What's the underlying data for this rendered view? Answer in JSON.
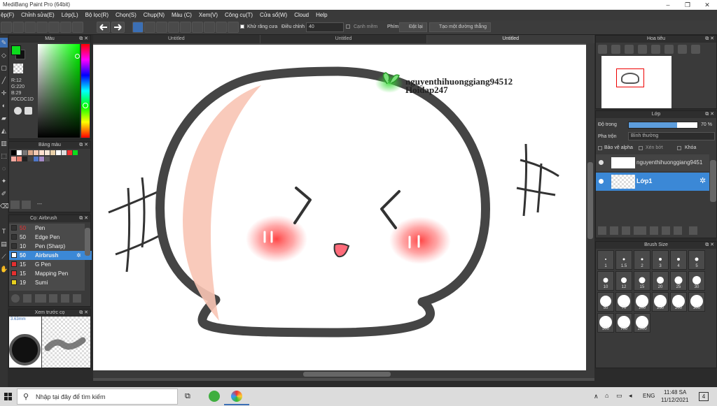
{
  "window": {
    "title": "MediBang Paint Pro (64bit)"
  },
  "menu": [
    "ệp(F)",
    "Chỉnh sửa(E)",
    "Lớp(L)",
    "Bộ lọc(R)",
    "Chọn(S)",
    "Chụp(N)",
    "Màu (C)",
    "Xem(V)",
    "Công cụ(T)",
    "Cửa sổ(W)",
    "Cloud",
    "Help"
  ],
  "toolbar": {
    "antialias_label": "Khử răng cưa",
    "correction_label": "Điều chỉnh",
    "correction_value": "40",
    "edge_label": "Cạnh mềm",
    "key_label": "Phím",
    "reset_label": "Đặt lại",
    "line_label": "Tạo một đường thẳng"
  },
  "tabs": [
    "Untitled",
    "Untitled",
    "Untitled"
  ],
  "color_panel": {
    "title": "Màu",
    "r": "R:12",
    "g": "G:220",
    "b": "B:29",
    "hex": "#0CDC1D",
    "current_color": "#0cdc1d"
  },
  "palette_panel": {
    "title": "Bảng màu",
    "footer": "---"
  },
  "brush_panel": {
    "title": "Cọ: Airbrush",
    "items": [
      {
        "size": "50",
        "name": "Pen",
        "color": "#333333"
      },
      {
        "size": "50",
        "name": "Edge Pen",
        "color": "#333333"
      },
      {
        "size": "10",
        "name": "Pen (Sharp)",
        "color": "#333333"
      },
      {
        "size": "50",
        "name": "Airbrush",
        "color": "#ffffff",
        "selected": true
      },
      {
        "size": "15",
        "name": "G Pen",
        "color": "#e53030"
      },
      {
        "size": "15",
        "name": "Mapping Pen",
        "color": "#e53030"
      },
      {
        "size": "19",
        "name": "Sumi",
        "color": "#e8d020"
      }
    ]
  },
  "preview_panel": {
    "title": "Xem trước cọ",
    "size": "3.63mm"
  },
  "canvas": {
    "watermark_line1": "nguyenthihuonggiang94512",
    "watermark_line2": "Hoidap247"
  },
  "navigator": {
    "title": "Hoa tiêu"
  },
  "layer_panel": {
    "title": "Lớp",
    "opacity_label": "Độ trong",
    "opacity_value": "70 %",
    "opacity": 0.7,
    "blend_label": "Pha trộn",
    "blend_value": "Bình thường",
    "protect_alpha": "Bảo vệ alpha",
    "clipping": "Xén bớt",
    "lock": "Khóa",
    "layers": [
      {
        "name": "nguyenthihuonggiang9451"
      },
      {
        "name": "Lớp1"
      }
    ]
  },
  "brush_size_panel": {
    "title": "Brush Size",
    "sizes": [
      "1",
      "1.5",
      "2",
      "3",
      "4",
      "5",
      "10",
      "12",
      "15",
      "20",
      "25",
      "30",
      "50",
      "70",
      "100",
      "150",
      "200",
      "300",
      "500",
      "700",
      "1000"
    ]
  },
  "taskbar": {
    "search_placeholder": "Nhập tại đây để tìm kiếm",
    "lang": "ENG",
    "time": "11:48 SA",
    "date": "11/12/2021",
    "notif_count": "4"
  }
}
